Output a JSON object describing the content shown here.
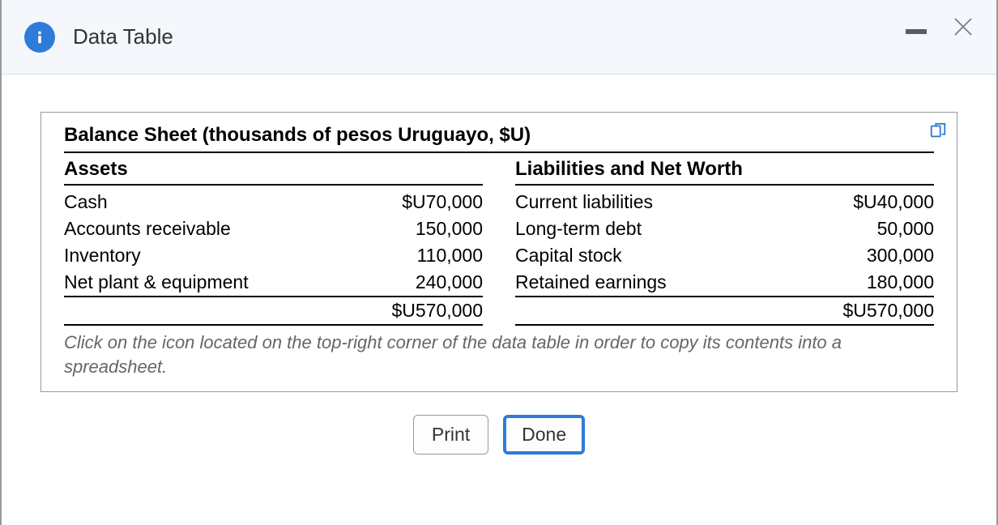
{
  "header": {
    "title": "Data Table"
  },
  "table": {
    "title": "Balance Sheet (thousands of pesos Uruguayo, $U)",
    "left_header": "Assets",
    "right_header": "Liabilities and Net Worth",
    "assets": [
      {
        "label": "Cash",
        "value": "$U70,000"
      },
      {
        "label": "Accounts receivable",
        "value": "150,000"
      },
      {
        "label": "Inventory",
        "value": "110,000"
      },
      {
        "label": "Net plant & equipment",
        "value": "240,000"
      }
    ],
    "assets_total": "$U570,000",
    "liabilities": [
      {
        "label": "Current liabilities",
        "value": "$U40,000"
      },
      {
        "label": "Long-term debt",
        "value": "50,000"
      },
      {
        "label": "Capital stock",
        "value": "300,000"
      },
      {
        "label": "Retained earnings",
        "value": "180,000"
      }
    ],
    "liabilities_total": "$U570,000",
    "hint": "Click on the icon located on the top-right corner of the data table in order to copy its contents into a spreadsheet."
  },
  "buttons": {
    "print": "Print",
    "done": "Done"
  }
}
